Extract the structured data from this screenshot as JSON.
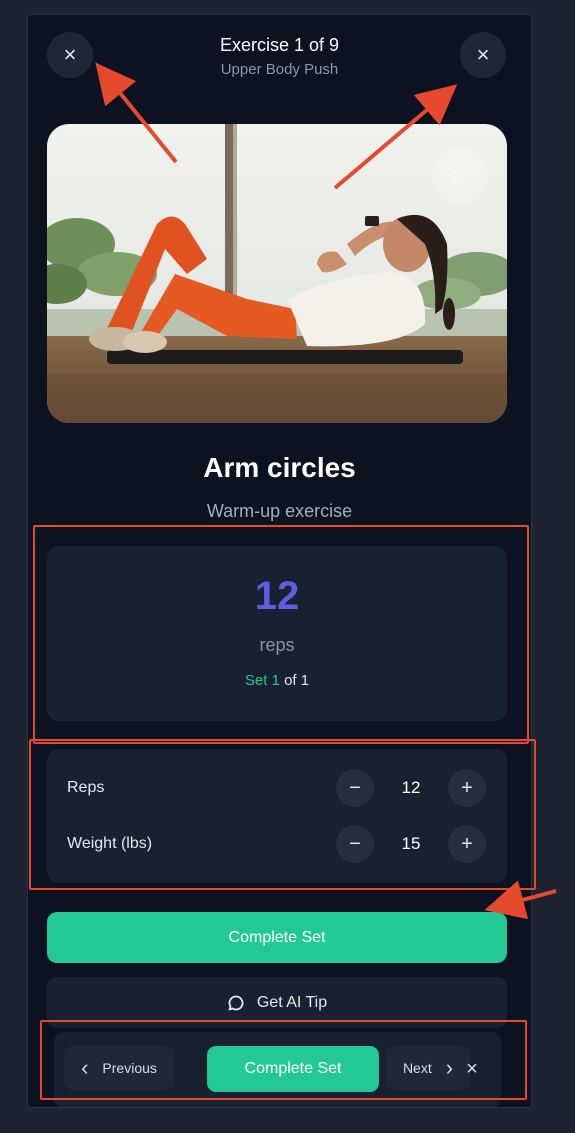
{
  "header": {
    "title": "Exercise 1 of 9",
    "subtitle": "Upper Body Push",
    "left_close_icon": "×",
    "right_close_icon": "×"
  },
  "media": {
    "image_alt": "Woman doing crunches on a mat",
    "play_icon": "▷"
  },
  "exercise": {
    "name": "Arm circles",
    "description": "Warm-up exercise"
  },
  "reps_card": {
    "target": "12",
    "unit": "reps",
    "set_word": "Set",
    "set_current": "1",
    "set_of": "of",
    "set_total": "1"
  },
  "adjust": {
    "reps_label": "Reps",
    "reps_value": "12",
    "weight_label": "Weight (lbs)",
    "weight_value": "15",
    "minus": "−",
    "plus": "+"
  },
  "actions": {
    "complete_set": "Complete Set",
    "ai_tip": "Get AI Tip"
  },
  "bottom_bar": {
    "previous": "Previous",
    "complete_set": "Complete Set",
    "next": "Next",
    "close": "×",
    "prev_chevron": "‹",
    "next_chevron": "›"
  },
  "colors": {
    "background": "#1d2331",
    "panel": "#0c1220",
    "card": "#182131",
    "accent_green": "#22c995",
    "accent_purple": "#5d5fe0",
    "annotation": "#e5492e"
  }
}
